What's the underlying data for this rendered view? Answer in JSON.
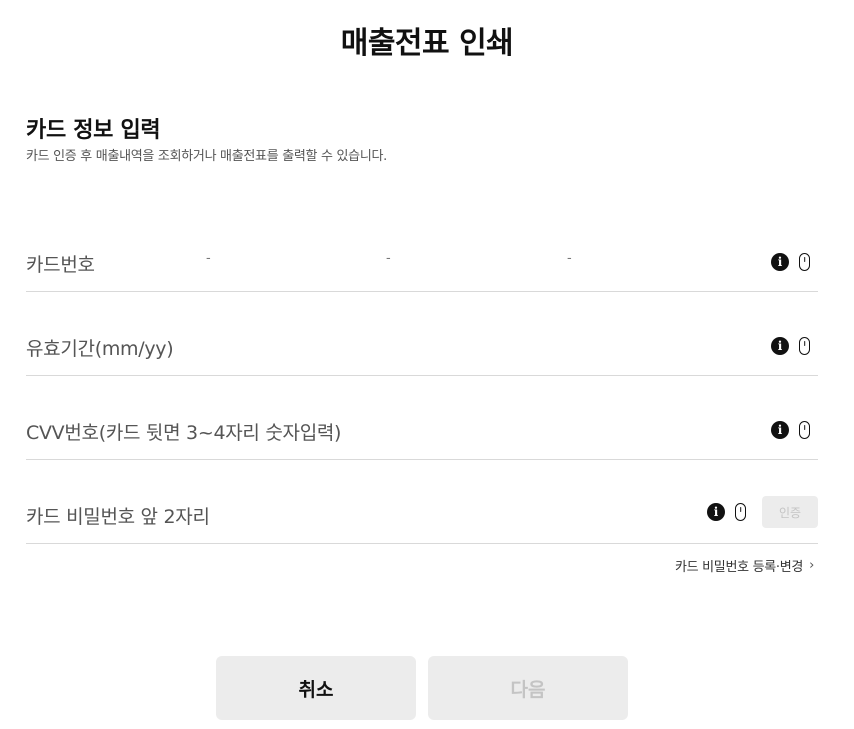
{
  "page": {
    "title": "매출전표 인쇄"
  },
  "section": {
    "title": "카드 정보 입력",
    "description": "카드 인증 후 매출내역을 조회하거나 매출전표를 출력할 수 있습니다."
  },
  "fields": {
    "card_number": {
      "label": "카드번호",
      "separator": "-",
      "seg1": "",
      "seg2": "",
      "seg3": "",
      "seg4": ""
    },
    "expiry": {
      "label": "유효기간(mm/yy)",
      "value": ""
    },
    "cvv": {
      "label": "CVV번호(카드 뒷면 3~4자리 숫자입력)",
      "value": ""
    },
    "password": {
      "label": "카드 비밀번호 앞 2자리",
      "value": "",
      "verify_label": "인증"
    }
  },
  "links": {
    "password_register": "카드 비밀번호 등록·변경",
    "chevron": "›"
  },
  "icons": {
    "info": "info-icon",
    "mouse": "mouse-icon",
    "chevron": "chevron-right-icon"
  },
  "icon_glyphs": {
    "info": "i"
  },
  "buttons": {
    "cancel": "취소",
    "next": "다음"
  },
  "colors": {
    "button_bg": "#ececec",
    "disabled_text": "#c4c4c4",
    "divider": "#d9d9d9"
  }
}
